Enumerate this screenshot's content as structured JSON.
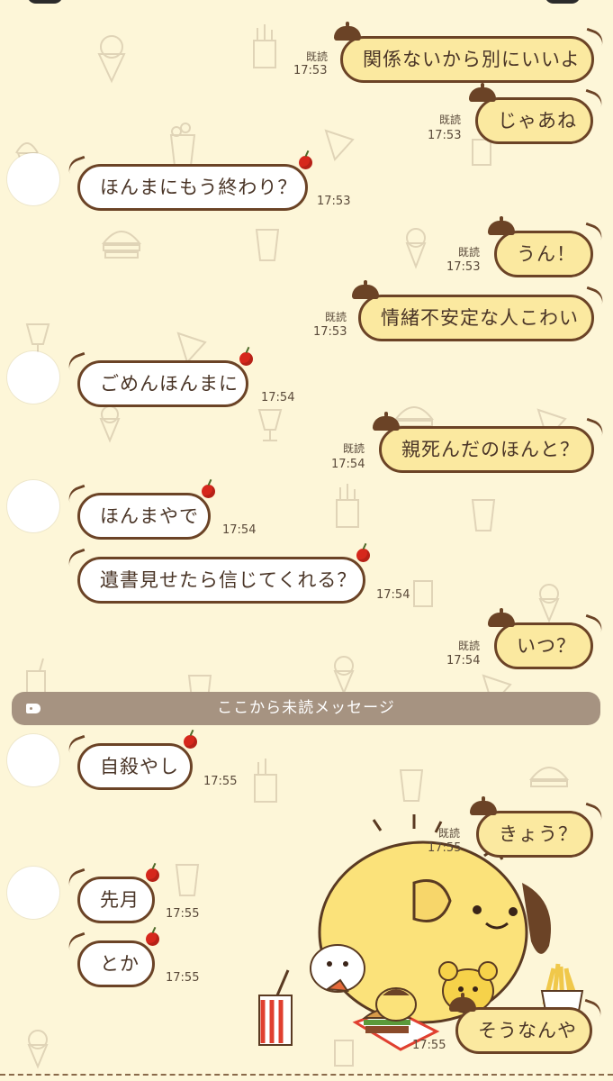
{
  "colors": {
    "background": "#fdf6d8",
    "outgoing_bubble": "#fbe9a0",
    "incoming_bubble": "#ffffff",
    "bubble_border": "#6b4326",
    "unread_divider": "#a69381",
    "cherry": "#d6271c"
  },
  "background_icons": [
    "ice-cream-icon",
    "fries-icon",
    "pizza-icon",
    "burger-icon",
    "popcorn-icon",
    "parfait-icon",
    "soft-serve-icon",
    "drink-icon"
  ],
  "unread_divider": {
    "label": "ここから未読メッセージ",
    "icon": "tag-icon"
  },
  "messages": [
    {
      "side": "out",
      "text": "関係ないから別にいいよ",
      "time": "17:53",
      "read": "既読"
    },
    {
      "side": "out",
      "text": "じゃあね",
      "time": "17:53",
      "read": "既読"
    },
    {
      "side": "in",
      "text": "ほんまにもう終わり？",
      "time": "17:53"
    },
    {
      "side": "out",
      "text": "うん！",
      "time": "17:53",
      "read": "既読"
    },
    {
      "side": "out",
      "text": "情緒不安定な人こわい",
      "time": "17:53",
      "read": "既読"
    },
    {
      "side": "in",
      "text": "ごめんほんまに",
      "time": "17:54"
    },
    {
      "side": "out",
      "text": "親死んだのほんと？",
      "time": "17:54",
      "read": "既読"
    },
    {
      "side": "in",
      "text": "ほんまやで",
      "time": "17:54"
    },
    {
      "side": "in",
      "text": "遺書見せたら信じてくれる？",
      "time": "17:54"
    },
    {
      "side": "out",
      "text": "いつ？",
      "time": "17:54",
      "read": "既読"
    },
    {
      "side": "in",
      "text": "自殺やし",
      "time": "17:55"
    },
    {
      "side": "out",
      "text": "きょう？",
      "time": "17:55",
      "read": "既読"
    },
    {
      "side": "in",
      "text": "先月",
      "time": "17:55"
    },
    {
      "side": "in",
      "text": "とか",
      "time": "17:55"
    },
    {
      "side": "out",
      "text": "そうなんや",
      "time": "17:55"
    }
  ],
  "sticker": {
    "icon": "pompompurin-sticker-icon"
  }
}
